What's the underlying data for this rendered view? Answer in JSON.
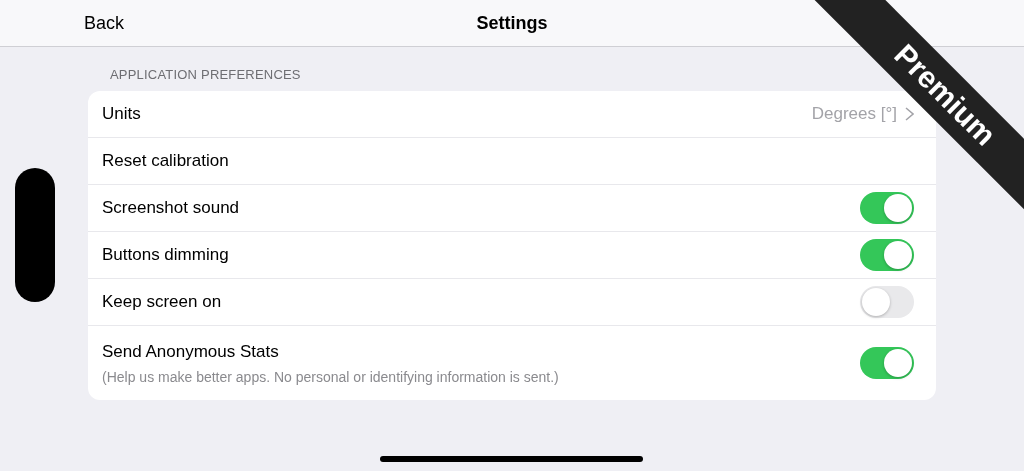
{
  "nav": {
    "back": "Back",
    "title": "Settings"
  },
  "ribbon": {
    "label": "Premium"
  },
  "section": {
    "header": "APPLICATION PREFERENCES",
    "rows": [
      {
        "kind": "value",
        "label": "Units",
        "value": "Degrees [°]"
      },
      {
        "kind": "action",
        "label": "Reset calibration"
      },
      {
        "kind": "toggle",
        "label": "Screenshot sound",
        "on": true
      },
      {
        "kind": "toggle",
        "label": "Buttons dimming",
        "on": true
      },
      {
        "kind": "toggle",
        "label": "Keep screen on",
        "on": false
      },
      {
        "kind": "toggle",
        "label": "Send Anonymous Stats",
        "note": "(Help us make better apps. No personal or identifying information is sent.)",
        "on": true
      }
    ]
  }
}
